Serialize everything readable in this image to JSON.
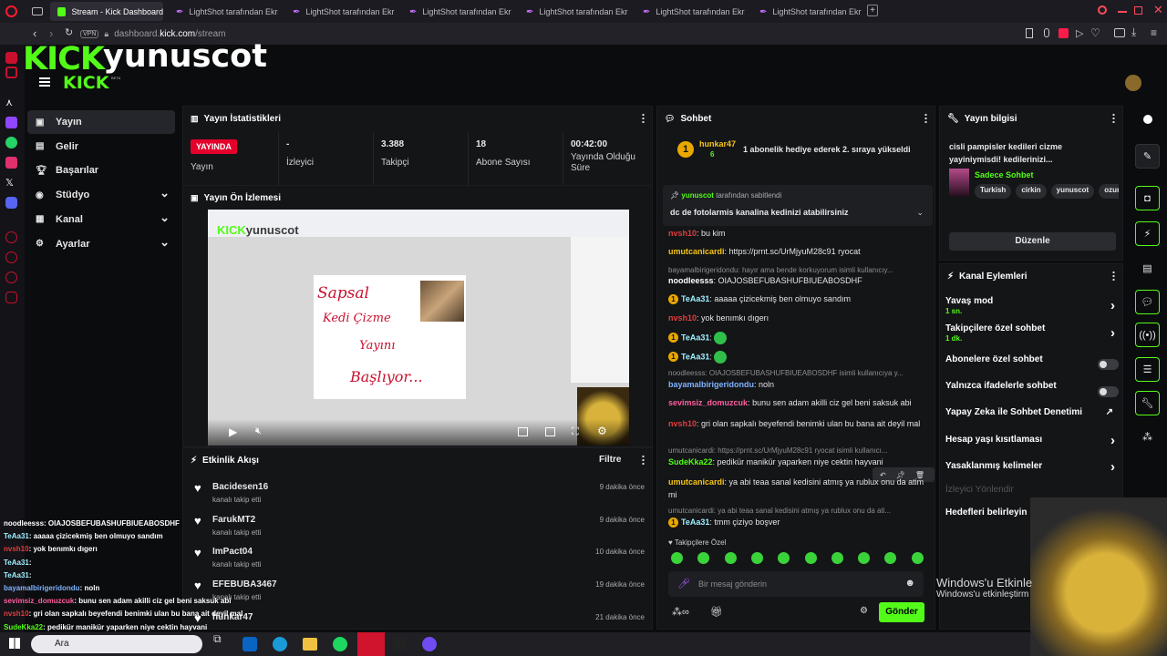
{
  "browser": {
    "tabs": [
      {
        "label": "Stream - Kick Dashboard",
        "active": true
      },
      {
        "label": "LightShot tarafından Ekra"
      },
      {
        "label": "LightShot tarafından Ekra"
      },
      {
        "label": "LightShot tarafından Ekra"
      },
      {
        "label": "LightShot tarafından Ekra"
      },
      {
        "label": "LightShot tarafından Ekra"
      },
      {
        "label": "LightShot tarafından Ekra"
      }
    ],
    "vpn": "VPN",
    "url_host": "dashboard.",
    "url_domain": "kick.com",
    "url_path": "/stream",
    "new_tab": "+"
  },
  "site": {
    "logo_kick": "KICK",
    "channel": "yunuscot",
    "logo_small": "KICK",
    "beta": "BETA"
  },
  "sidebar": {
    "items": [
      {
        "label": "Yayın",
        "icon": "home-icon",
        "active": true
      },
      {
        "label": "Gelir",
        "icon": "money-icon"
      },
      {
        "label": "Başarılar",
        "icon": "trophy-icon"
      },
      {
        "label": "Stüdyo",
        "icon": "studio-icon",
        "chevron": true
      },
      {
        "label": "Kanal",
        "icon": "channel-icon",
        "chevron": true
      },
      {
        "label": "Ayarlar",
        "icon": "gear-icon",
        "chevron": true
      }
    ]
  },
  "stats": {
    "title": "Yayın İstatistikleri",
    "live_badge": "YAYINDA",
    "items": [
      {
        "value": "",
        "label": "Yayın"
      },
      {
        "value": "-",
        "label": "İzleyici"
      },
      {
        "value": "3.388",
        "label": "Takipçi"
      },
      {
        "value": "18",
        "label": "Abone Sayısı"
      },
      {
        "value": "00:42:00",
        "label": "Yayında Olduğu Süre"
      }
    ]
  },
  "preview": {
    "title": "Yayın Ön İzlemesi",
    "overlay_name": "yunuscot",
    "drawing_lines": [
      "Sapsal",
      "Kedi Çizme",
      "Yayını",
      "Başlıyor..."
    ]
  },
  "activity": {
    "title": "Etkinlik Akışı",
    "filter": "Filtre",
    "items": [
      {
        "user": "Bacidesen16",
        "sub": "kanalı takip etti",
        "time": "9 dakika önce"
      },
      {
        "user": "FarukMT2",
        "sub": "kanalı takip etti",
        "time": "9 dakika önce"
      },
      {
        "user": "ImPact04",
        "sub": "kanalı takip etti",
        "time": "10 dakika önce"
      },
      {
        "user": "EFEBUBA3467",
        "sub": "kanalı takip etti",
        "time": "19 dakika önce"
      },
      {
        "user": "hunkar47",
        "sub": "",
        "time": "21 dakika önce"
      }
    ]
  },
  "chat": {
    "title": "Sohbet",
    "top_gifter": {
      "rank": "1",
      "name": "hunkar47",
      "count": "6",
      "message": "1 abonelik hediye ederek 2. sıraya yükseldi"
    },
    "pinned": {
      "by_user": "yunuscot",
      "by_text": "tarafından sabitlendi",
      "message": "dc de fotolarmis kanalina kedinizi atabilirsiniz"
    },
    "messages": [
      {
        "user": "nvsh10",
        "color": "#e23d3d",
        "text": "bu kim"
      },
      {
        "user": "umutcanicardi",
        "color": "#f5c518",
        "text": "https://prnt.sc/UrMjyuM28c91 ryocat"
      },
      {
        "reply": "bayamalbirigeridondu: hayır ama bende korkuyorum isimli kullanıcıy..."
      },
      {
        "user": "noodleesss",
        "color": "#ffffff",
        "text": "OIAJOSBEFUBASHUFBIUEABOSDHF"
      },
      {
        "user": "TeAa31",
        "color": "#9ef0ff",
        "text": "aaaaa çizicekmiş ben olmuyo sandım",
        "badge": true
      },
      {
        "user": "nvsh10",
        "color": "#e23d3d",
        "text": "yok benımkı dıgerı"
      },
      {
        "user": "TeAa31",
        "color": "#9ef0ff",
        "text": "",
        "badge": true,
        "emote": true
      },
      {
        "user": "TeAa31",
        "color": "#9ef0ff",
        "text": "",
        "badge": true,
        "emote": true
      },
      {
        "reply": "noodleesss: OIAJOSBEFUBASHUFBIUEABOSDHF isimli kullanıcıya y..."
      },
      {
        "user": "bayamalbirigeridondu",
        "color": "#7fb2ff",
        "text": "noln"
      },
      {
        "user": "sevimsiz_domuzcuk",
        "color": "#ff5ea0",
        "text": "bunu sen adam akilli ciz gel beni saksuk abi"
      },
      {
        "user": "nvsh10",
        "color": "#e23d3d",
        "text": "gri olan sapkalı beyefendi benimki ulan bu bana ait deyil mal"
      },
      {
        "reply": "umutcanicardi: https://prnt.sc/UrMjyuM28c91 ryocat isimli kullanıcı..."
      },
      {
        "user": "SudeKka22",
        "color": "#53fc18",
        "text": "pedikür manikür yaparken niye cektin hayvani"
      },
      {
        "user": "umutcanicardi",
        "color": "#f5c518",
        "text": "ya abi teaa sanal kedisini atmış ya rublux onu da atim mi"
      },
      {
        "reply": "umutcanicardi: ya abi teaa sanal kedisini atmış ya rublux onu da ati..."
      },
      {
        "user": "TeAa31",
        "color": "#9ef0ff",
        "text": "tmm çiziyo boşver",
        "badge": true
      }
    ],
    "followers_only": "Takipçilere Özel",
    "input_placeholder": "Bir mesaj gönderin",
    "send": "Gönder"
  },
  "info": {
    "title": "Yayın bilgisi",
    "stream_title": "cisli pampisler kedileri cizme yayiniymisdi! kedilerinizi...",
    "category": "Sadece Sohbet",
    "tags": [
      "Turkish",
      "cirkin",
      "yunuscot",
      "ozur"
    ],
    "edit": "Düzenle"
  },
  "actions": {
    "title": "Kanal Eylemleri",
    "items": [
      {
        "label": "Yavaş mod",
        "sub": "1 sn.",
        "type": "chevron"
      },
      {
        "label": "Takipçilere özel sohbet",
        "sub": "1 dk.",
        "type": "chevron"
      },
      {
        "label": "Abonelere özel sohbet",
        "type": "toggle"
      },
      {
        "label": "Yalnızca ifadelerle sohbet",
        "type": "toggle"
      },
      {
        "label": "Yapay Zeka ile Sohbet Denetimi",
        "type": "external"
      },
      {
        "label": "Hesap yaşı kısıtlaması",
        "type": "chevron"
      },
      {
        "label": "Yasaklanmış kelimeler",
        "type": "chevron"
      },
      {
        "label": "İzleyici Yönlendir",
        "type": "disabled"
      },
      {
        "label": "Hedefleri belirleyin",
        "type": "none"
      }
    ]
  },
  "overlay_chat": [
    {
      "user": "noodleesss",
      "text": "OIAJOSBEFUBASHUFBIUEABOSDHF",
      "color": "#ffffff"
    },
    {
      "user": "TeAa31",
      "text": "aaaaa çizicekmiş ben olmuyo sandım",
      "color": "#9ef0ff"
    },
    {
      "user": "nvsh10",
      "text": "yok benımkı dıgerı",
      "color": "#e23d3d"
    },
    {
      "user": "TeAa31",
      "text": "",
      "color": "#9ef0ff"
    },
    {
      "user": "TeAa31",
      "text": "",
      "color": "#9ef0ff"
    },
    {
      "user": "bayamalbirigeridondu",
      "text": "noln",
      "color": "#7fb2ff"
    },
    {
      "user": "sevimsiz_domuzcuk",
      "text": "bunu sen adam akilli ciz gel beni saksuk abi",
      "color": "#ff5ea0"
    },
    {
      "user": "nvsh10",
      "text": "gri olan sapkalı beyefendi benimki ulan bu bana ait deyil mal",
      "color": "#e23d3d"
    },
    {
      "user": "SudeKka22",
      "text": "pedikür manikür yaparken niye cektin hayvani",
      "color": "#53fc18"
    }
  ],
  "windows": {
    "watermark_title": "Windows'u Etkinle",
    "watermark_sub": "Windows'u etkinleştirm",
    "search": "Ara"
  },
  "colors": {
    "accent": "#53fc18",
    "live": "#e4002b",
    "bg": "#0b0c0e",
    "panel": "#141517"
  }
}
